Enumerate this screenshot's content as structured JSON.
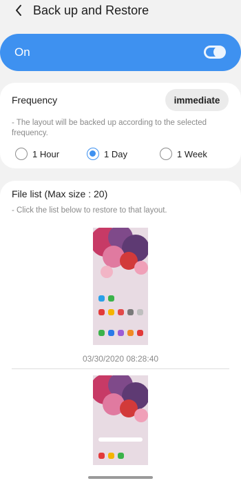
{
  "header": {
    "title": "Back up and Restore",
    "back_icon": "chevron-left-icon"
  },
  "master_switch": {
    "label": "On",
    "state": true,
    "color": "#3e91f0"
  },
  "frequency": {
    "label": "Frequency",
    "value": "immediate",
    "description": "- The layout will be backed up according to the selected frequency.",
    "options": [
      {
        "label": "1 Hour",
        "selected": false
      },
      {
        "label": "1 Day",
        "selected": true
      },
      {
        "label": "1 Week",
        "selected": false
      }
    ]
  },
  "file_list": {
    "title": "File list (Max size : 20)",
    "description": "- Click the list below to restore to that layout.",
    "items": [
      {
        "timestamp": "03/30/2020 08:28:40"
      },
      {
        "timestamp": ""
      }
    ]
  }
}
